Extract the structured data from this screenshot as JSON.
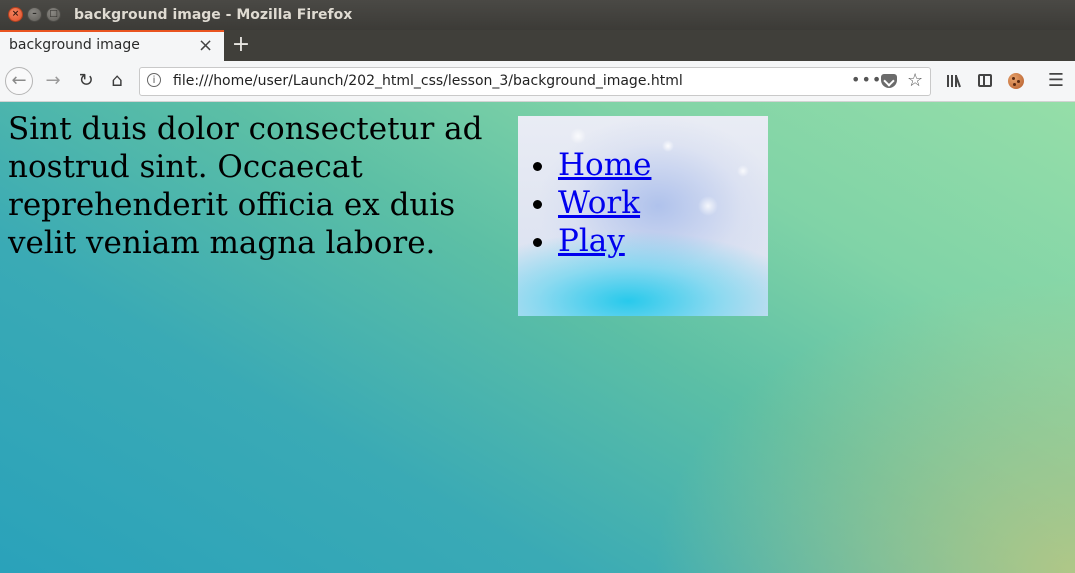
{
  "window": {
    "title": "background image - Mozilla Firefox",
    "controls": {
      "close": "×",
      "minimize": "–",
      "maximize": "□"
    }
  },
  "tabs": [
    {
      "label": "background image",
      "close": "×",
      "active": true
    }
  ],
  "new_tab_label": "+",
  "navbar": {
    "back": "←",
    "forward": "→",
    "reload": "↻",
    "home": "⌂",
    "info": "i",
    "url": "file:///home/user/Launch/202_html_css/lesson_3/background_image.html",
    "more": "•••",
    "bookmark_star": "☆",
    "menu": "☰"
  },
  "page": {
    "paragraph": "Sint duis dolor consectetur ad nostrud sint. Occaecat reprehenderit officia ex duis velit veniam magna labore.",
    "nav_links": [
      "Home",
      "Work",
      "Play"
    ]
  },
  "colors": {
    "accent_tab": "#e95420",
    "link": "#0000ee"
  },
  "icons": [
    "close-icon",
    "minimize-icon",
    "maximize-icon",
    "back-icon",
    "forward-icon",
    "reload-icon",
    "home-icon",
    "info-icon",
    "pocket-icon",
    "star-icon",
    "library-icon",
    "sidebar-icon",
    "profile-icon",
    "menu-icon"
  ]
}
